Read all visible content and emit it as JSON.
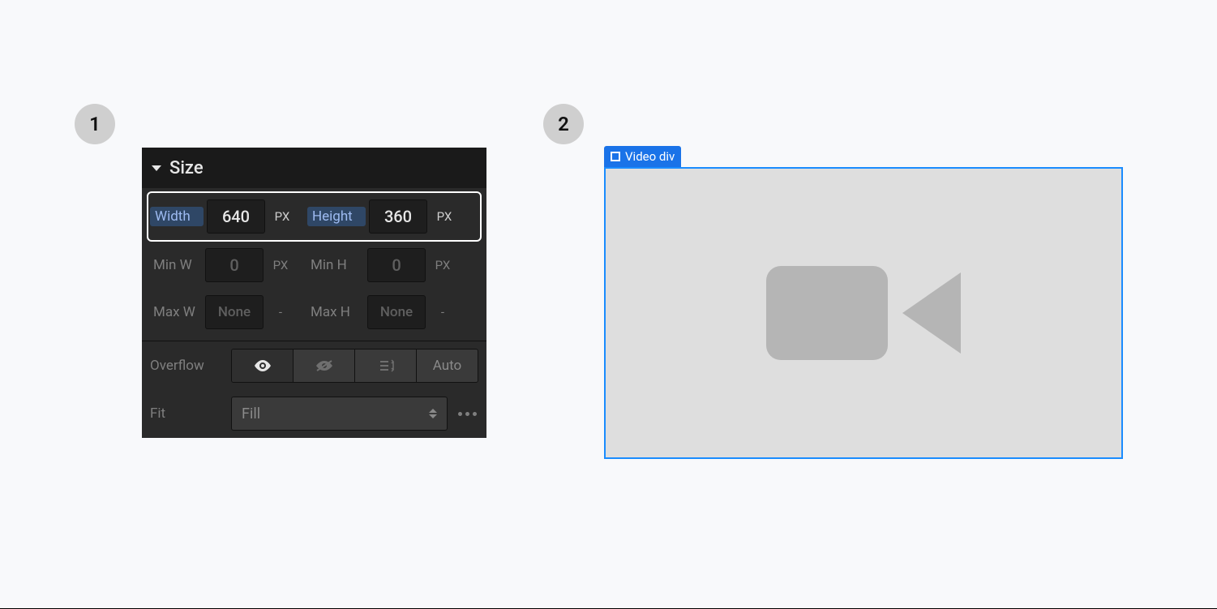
{
  "steps": {
    "one": "1",
    "two": "2"
  },
  "panel": {
    "title": "Size",
    "width": {
      "label": "Width",
      "value": "640",
      "unit": "PX"
    },
    "height": {
      "label": "Height",
      "value": "360",
      "unit": "PX"
    },
    "minw": {
      "label": "Min W",
      "value": "0",
      "unit": "PX"
    },
    "minh": {
      "label": "Min H",
      "value": "0",
      "unit": "PX"
    },
    "maxw": {
      "label": "Max W",
      "value": "None",
      "unit": "-"
    },
    "maxh": {
      "label": "Max H",
      "value": "None",
      "unit": "-"
    },
    "overflow": {
      "label": "Overflow",
      "auto": "Auto"
    },
    "fit": {
      "label": "Fit",
      "value": "Fill"
    }
  },
  "preview": {
    "tag": "Video div"
  }
}
